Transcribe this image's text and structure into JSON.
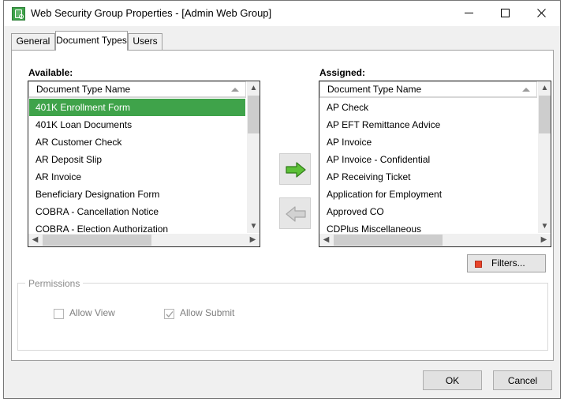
{
  "window": {
    "title": "Web Security Group Properties - [Admin Web Group]",
    "icon": "web-security-group-icon",
    "controls": {
      "minimize": "minimize-icon",
      "maximize": "maximize-icon",
      "close": "close-icon"
    }
  },
  "tabs": [
    {
      "label": "General",
      "active": false
    },
    {
      "label": "Document Types",
      "active": true
    },
    {
      "label": "Users",
      "active": false
    }
  ],
  "available": {
    "label": "Available:",
    "column_header": "Document Type Name",
    "sort": "ascending",
    "items": [
      {
        "label": "401K Enrollment Form",
        "selected": true
      },
      {
        "label": "401K Loan Documents",
        "selected": false
      },
      {
        "label": "AR Customer Check",
        "selected": false
      },
      {
        "label": "AR Deposit Slip",
        "selected": false
      },
      {
        "label": "AR Invoice",
        "selected": false
      },
      {
        "label": "Beneficiary Designation Form",
        "selected": false
      },
      {
        "label": "COBRA - Cancellation Notice",
        "selected": false
      },
      {
        "label": "COBRA - Election Authorization",
        "selected": false
      }
    ]
  },
  "assigned": {
    "label": "Assigned:",
    "column_header": "Document Type Name",
    "sort": "ascending",
    "items": [
      {
        "label": "AP Check",
        "selected": false
      },
      {
        "label": "AP EFT Remittance Advice",
        "selected": false
      },
      {
        "label": "AP Invoice",
        "selected": false
      },
      {
        "label": "AP Invoice - Confidential",
        "selected": false
      },
      {
        "label": "AP Receiving Ticket",
        "selected": false
      },
      {
        "label": "Application for Employment",
        "selected": false
      },
      {
        "label": "Approved CO",
        "selected": false
      },
      {
        "label": "CDPlus Miscellaneous",
        "selected": false
      }
    ]
  },
  "transfer": {
    "assign_icon": "arrow-right-icon",
    "unassign_icon": "arrow-left-icon",
    "assign_enabled": true,
    "unassign_enabled": false
  },
  "filters": {
    "label": "Filters...",
    "icon": "filter-icon"
  },
  "permissions": {
    "legend": "Permissions",
    "options": [
      {
        "label": "Allow View",
        "checked": false,
        "enabled": false
      },
      {
        "label": "Allow Submit",
        "checked": true,
        "enabled": false
      }
    ]
  },
  "footer": {
    "ok": "OK",
    "cancel": "Cancel"
  },
  "colors": {
    "selection_green": "#3fa34a",
    "arrow_green": "#5cc037",
    "filter_red": "#e8442a",
    "window_bg": "#f0f0f0"
  }
}
